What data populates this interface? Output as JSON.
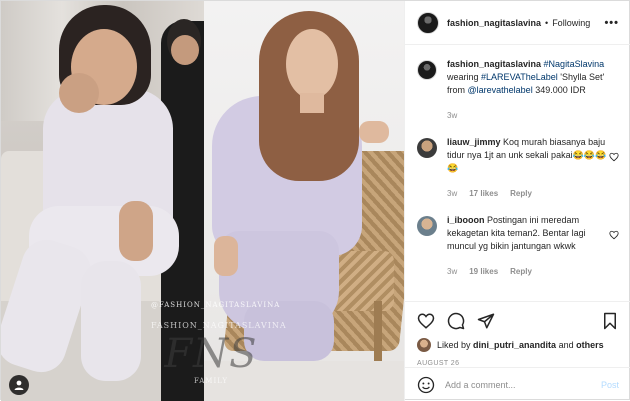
{
  "post": {
    "username": "fashion_nagitaslavina",
    "separator": "•",
    "follow_label": "Following",
    "more_label": "•••"
  },
  "photo": {
    "watermark_line1": "@FASHION_NAGITASLAVINA",
    "watermark_line2": "FASHION_NAGITASLAVINA",
    "watermark_logo": "FNS",
    "watermark_line3": "FAMILY",
    "watermark_line4": "@FASHIONNAGITASLAVINA"
  },
  "caption": {
    "username": "fashion_nagitaslavina",
    "hashtag1": "#NagitaSlavina",
    "text1": "wearing",
    "hashtag2": "#LAREVATheLabel",
    "text2": "'Shylla Set' from",
    "mention": "@larevathelabel",
    "text3": "349.000 IDR",
    "age": "3w"
  },
  "comments": [
    {
      "username": "liauw_jimmy",
      "text": "Koq murah biasanya baju tidur nya 1jt an unk sekali pakai😂😂😂😂",
      "age": "3w",
      "likes": "17 likes",
      "reply": "Reply"
    },
    {
      "username": "i_ibooon",
      "text": "Postingan ini meredam kekagetan kita teman2. Bentar lagi muncul yg bikin jantungan wkwk",
      "age": "3w",
      "likes": "19 likes",
      "reply": "Reply"
    }
  ],
  "likes": {
    "prefix": "Liked by",
    "user": "dini_putri_anandita",
    "and": "and",
    "others": "others"
  },
  "date": "AUGUST 26",
  "add_comment": {
    "placeholder": "Add a comment...",
    "post_label": "Post"
  },
  "icons": {
    "heart": "heart-icon",
    "comment": "comment-icon",
    "share": "share-icon",
    "bookmark": "bookmark-icon",
    "emoji": "emoji-icon",
    "user_tag": "user-tag-icon"
  },
  "colors": {
    "link": "#00376b",
    "muted": "#8e8e8e",
    "post_disabled": "#b3dbff",
    "border": "#efefef"
  }
}
